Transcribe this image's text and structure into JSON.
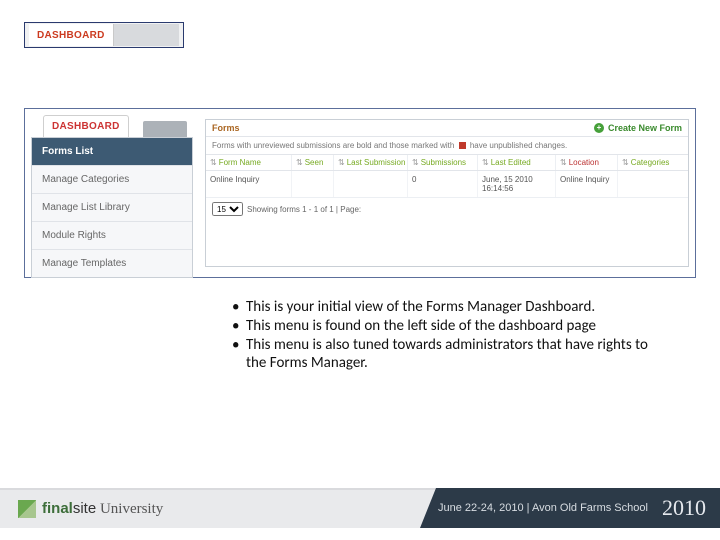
{
  "miniBadge": {
    "label": "DASHBOARD"
  },
  "tab": {
    "label": "DASHBOARD"
  },
  "sidebar": {
    "items": [
      {
        "label": "Forms List",
        "active": true
      },
      {
        "label": "Manage Categories"
      },
      {
        "label": "Manage List Library"
      },
      {
        "label": "Module Rights"
      },
      {
        "label": "Manage Templates"
      }
    ]
  },
  "forms": {
    "title": "Forms",
    "createLabel": "Create New Form",
    "note_a": "Forms with unreviewed submissions are bold and those marked with",
    "note_b": "have unpublished changes.",
    "columns": {
      "name": "Form Name",
      "seen": "Seen",
      "lastSub": "Last Submission",
      "subs": "Submissions",
      "edited": "Last Edited",
      "location": "Location",
      "categories": "Categories"
    },
    "rows": [
      {
        "name": "Online Inquiry",
        "seen": "",
        "lastSub": "",
        "subs": "0",
        "edited": "June, 15 2010 16:14:56",
        "location": "Online Inquiry",
        "categories": ""
      }
    ],
    "pager": {
      "perPage": "15",
      "text": "Showing forms 1 - 1 of 1 | Page:"
    }
  },
  "bullets": [
    "This is your initial view of the Forms Manager Dashboard.",
    "This menu is found on the left side of the dashboard page",
    "This menu is also tuned towards administrators that have rights to the Forms Manager."
  ],
  "footer": {
    "brandBold": "final",
    "brandRest": "site",
    "brandUni": " University",
    "dates": "June 22-24, 2010 | Avon Old Farms School",
    "year": "2010"
  }
}
